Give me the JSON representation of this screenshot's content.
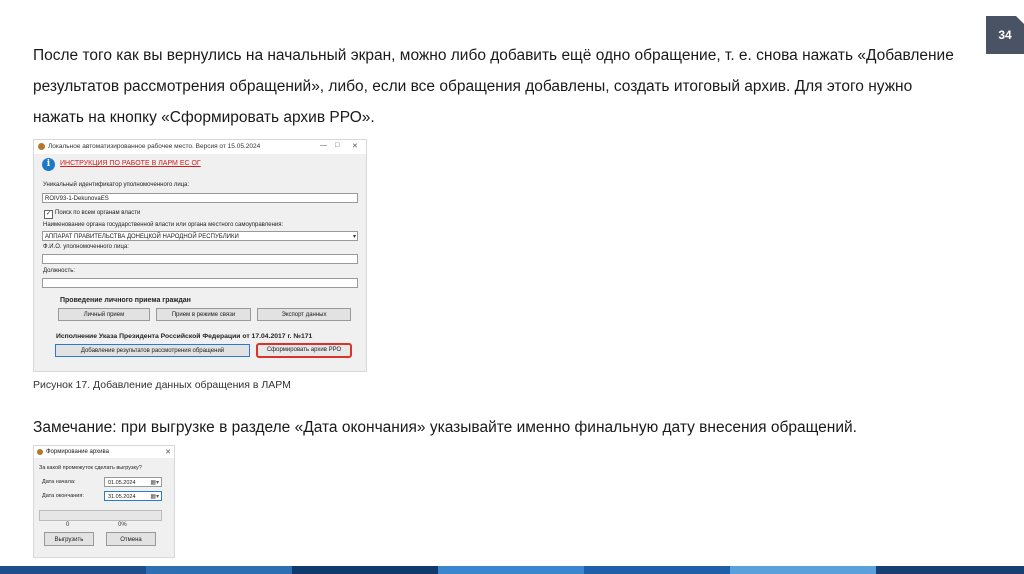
{
  "slide": {
    "page_number": "34",
    "paragraph1": "После того как вы вернулись на начальный экран, можно либо добавить ещё одно обращение, т. е. снова нажать «Добавление результатов рассмотрения обращений», либо, если все обращения добавлены, создать итоговый архив. Для этого нужно нажать на кнопку «Сформировать архив РРО».",
    "caption": "Рисунок 17. Добавление данных обращения в ЛАРМ",
    "paragraph2": "Замечание: при выгрузке в разделе «Дата окончания» указывайте именно финальную дату внесения обращений."
  },
  "screenshot1": {
    "window_title": "Локальное автоматизированное рабочее место. Версия от 15.05.2024",
    "window_controls": [
      "—",
      "□",
      "✕"
    ],
    "info_link": "ИНСТРУКЦИЯ ПО РАБОТЕ В ЛАРМ ЕС ОГ",
    "id_label": "Уникальный идентификатор уполномоченного лица:",
    "id_value": "ROIV93-1-DekunovaES",
    "checkbox_label": "Поиск по всем органам власти",
    "checkbox_checked": true,
    "org_label": "Наименование органа государственной власти или органа местного самоуправления:",
    "org_value": "АППАРАТ ПРАВИТЕЛЬСТВА ДОНЕЦКОЙ НАРОДНОЙ РЕСПУБЛИКИ",
    "fio_label": "Ф.И.О. уполномоченного лица:",
    "fio_value": "",
    "position_label": "Должность:",
    "position_value": "",
    "section1_title": "Проведение личного приема граждан",
    "btn_personal": "Личный прием",
    "btn_online": "Прием в режиме связи",
    "btn_export": "Экспорт данных",
    "section2_title": "Исполнение Указа Президента Российской Федерации от 17.04.2017 г. №171",
    "btn_add_results": "Добавление результатов рассмотрения обращений",
    "btn_form_archive": "Сформировать архив РРО"
  },
  "screenshot2": {
    "window_title": "Формирование архива",
    "close": "✕",
    "question": "За какой промежуток сделать выгрузку?",
    "start_label": "Дата начала:",
    "start_value": "01.05.2024",
    "end_label": "Дата окончания:",
    "end_value": "31.05.2024",
    "count_left": "0",
    "count_right": "0%",
    "btn_export": "Выгрузить",
    "btn_cancel": "Отмена"
  },
  "footer_colors": [
    "#1f4e8c",
    "#2d6fb3",
    "#0e3a6e",
    "#3a86cf",
    "#1f5ea8",
    "#5aa0dd",
    "#163f73"
  ]
}
